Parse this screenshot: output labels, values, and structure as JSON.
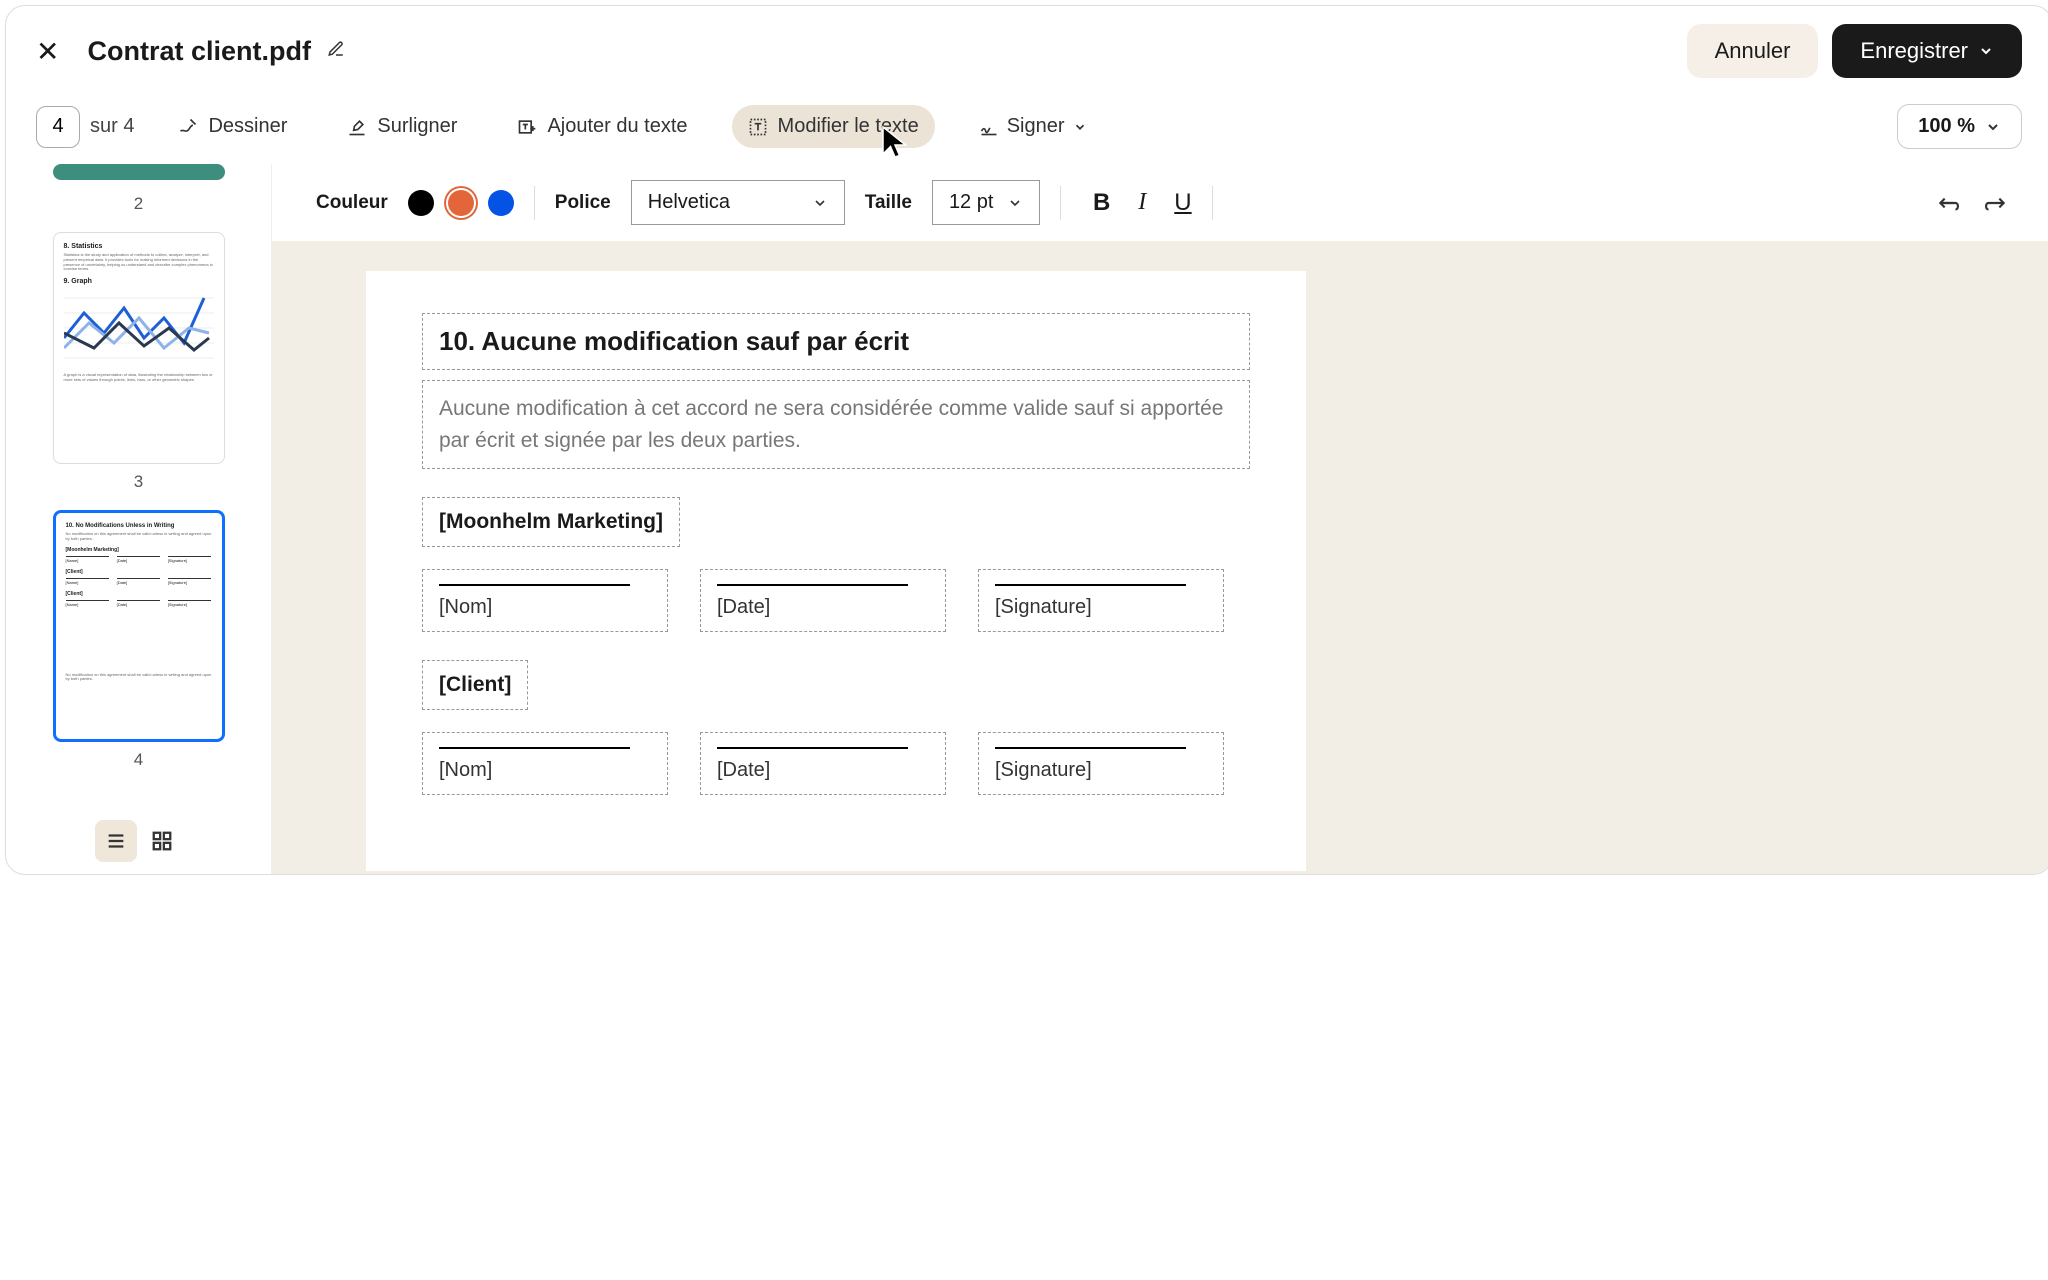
{
  "header": {
    "doc_title": "Contrat client.pdf",
    "cancel_label": "Annuler",
    "save_label": "Enregistrer"
  },
  "toolbar": {
    "page_current": "4",
    "page_total": "sur 4",
    "tool_draw": "Dessiner",
    "tool_highlight": "Surligner",
    "tool_addtext": "Ajouter du texte",
    "tool_edittext": "Modifier le texte",
    "tool_sign": "Signer",
    "zoom": "100 %"
  },
  "format": {
    "color_label": "Couleur",
    "font_label": "Police",
    "font_value": "Helvetica",
    "size_label": "Taille",
    "size_value": "12 pt",
    "colors": {
      "black": "#000000",
      "orange": "#e2663a",
      "blue": "#0453e4"
    }
  },
  "thumbs": {
    "n2": "2",
    "n3": "3",
    "n4": "4",
    "p3": {
      "h1": "8. Statistics",
      "t1": "Statistics is the study and application of methods to collect, analyze, interpret, and present empirical data. It provides tools for making informed decisions in the presence of uncertainty, helping us understand and describe complex phenomena in concise terms.",
      "h2": "9. Graph",
      "t2": "A graph is a visual representation of data, illustrating the relationship between two or more sets of values through points, lines, bars, or other geometric shapes."
    },
    "p4": {
      "h1": "10. No Modifications Unless in Writing",
      "t1": "No modification on this agreement shall be valid unless in writing and agreed upon by both parties.",
      "party1": "[Moonhelm Marketing]",
      "party2": "[Client]",
      "name": "[Name]",
      "date": "[Date]",
      "sig": "[Signature]",
      "footer": "No modification on this agreement shall be valid unless in writing and agreed upon by both parties."
    }
  },
  "page": {
    "title": "10. Aucune modification sauf par écrit",
    "body": "Aucune modification à cet accord ne sera considérée comme valide sauf si apportée par écrit et signée par les deux parties.",
    "party1": "[Moonhelm Marketing]",
    "party2": "[Client]",
    "name": "[Nom]",
    "date": "[Date]",
    "signature": "[Signature]"
  }
}
